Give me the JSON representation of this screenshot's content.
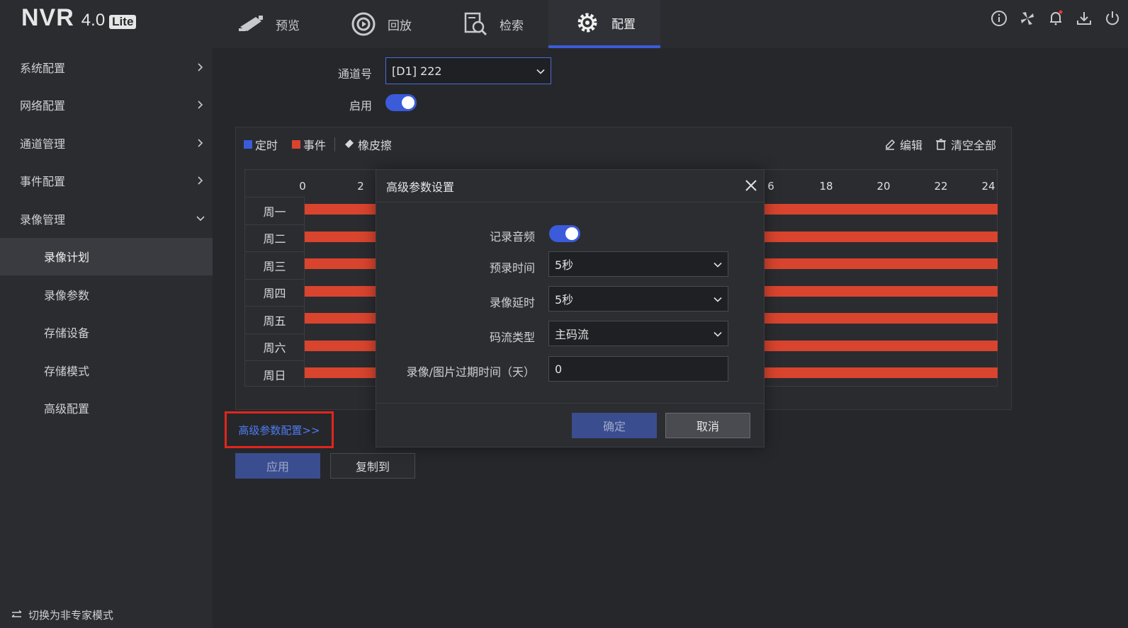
{
  "app": {
    "logo_main": "NVR",
    "logo_version": "4.0",
    "logo_edition": "Lite"
  },
  "nav": [
    {
      "label": "预览",
      "icon": "camera-icon"
    },
    {
      "label": "回放",
      "icon": "playback-icon"
    },
    {
      "label": "检索",
      "icon": "search-file-icon"
    },
    {
      "label": "配置",
      "icon": "gear-icon",
      "active": true
    }
  ],
  "top_icons": [
    "info-icon",
    "fan-icon",
    "bell-icon",
    "download-icon",
    "power-icon"
  ],
  "sidebar": {
    "items": [
      {
        "label": "系统配置"
      },
      {
        "label": "网络配置"
      },
      {
        "label": "通道管理"
      },
      {
        "label": "事件配置"
      },
      {
        "label": "录像管理",
        "expanded": true
      }
    ],
    "sub_items": [
      {
        "label": "录像计划",
        "active": true
      },
      {
        "label": "录像参数"
      },
      {
        "label": "存储设备"
      },
      {
        "label": "存储模式"
      },
      {
        "label": "高级配置"
      }
    ],
    "footer": "切换为非专家模式"
  },
  "form": {
    "channel_label": "通道号",
    "channel_value": "[D1] 222",
    "enable_label": "启用",
    "enable_on": true
  },
  "legend": {
    "timed": "定时",
    "event": "事件",
    "eraser": "橡皮擦",
    "timed_color": "#3b5bdb",
    "event_color": "#d9442e"
  },
  "tools": {
    "edit": "编辑",
    "clear_all": "清空全部"
  },
  "schedule": {
    "days": [
      "周一",
      "周二",
      "周三",
      "周四",
      "周五",
      "周六",
      "周日"
    ],
    "hour_labels_left": [
      "0",
      "2"
    ],
    "hour_labels_right": [
      "6",
      "18",
      "20",
      "22",
      "24"
    ]
  },
  "modal": {
    "title": "高级参数设置",
    "record_audio_label": "记录音频",
    "record_audio_on": true,
    "pre_record_label": "预录时间",
    "pre_record_value": "5秒",
    "post_record_label": "录像延时",
    "post_record_value": "5秒",
    "stream_type_label": "码流类型",
    "stream_type_value": "主码流",
    "expire_label": "录像/图片过期时间（天）",
    "expire_value": "0",
    "ok": "确定",
    "cancel": "取消"
  },
  "advanced_link": "高级参数配置>>",
  "buttons": {
    "apply": "应用",
    "copy_to": "复制到"
  }
}
